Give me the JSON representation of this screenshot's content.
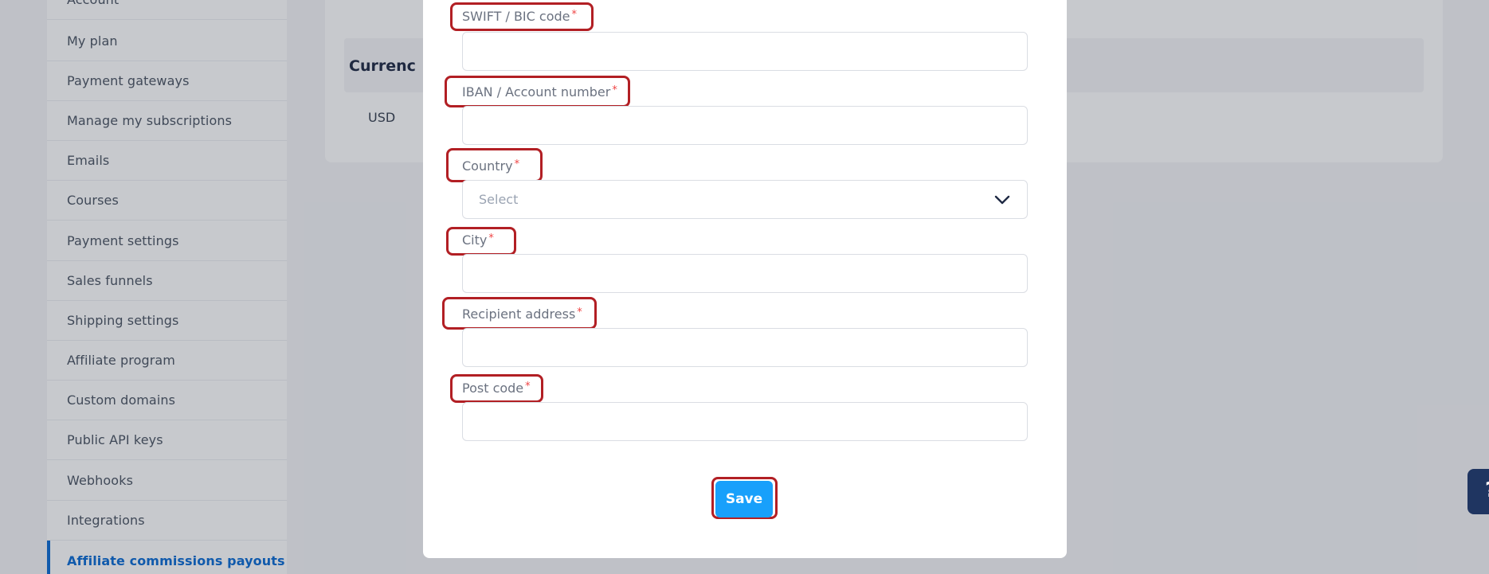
{
  "sidebar": {
    "items": [
      {
        "label": "Account"
      },
      {
        "label": "My plan"
      },
      {
        "label": "Payment gateways"
      },
      {
        "label": "Manage my subscriptions"
      },
      {
        "label": "Emails"
      },
      {
        "label": "Courses"
      },
      {
        "label": "Payment settings"
      },
      {
        "label": "Sales funnels"
      },
      {
        "label": "Shipping settings"
      },
      {
        "label": "Affiliate program"
      },
      {
        "label": "Custom domains"
      },
      {
        "label": "Public API keys"
      },
      {
        "label": "Webhooks"
      },
      {
        "label": "Integrations"
      },
      {
        "label": "Affiliate commissions payouts"
      }
    ],
    "active_item": "Affiliate commissions payouts"
  },
  "card": {
    "title": "Currenc",
    "value": "USD"
  },
  "modal": {
    "fields": {
      "swift": {
        "label": "SWIFT / BIC code",
        "required_mark": "*",
        "value": ""
      },
      "iban": {
        "label": "IBAN / Account number",
        "required_mark": "*",
        "value": ""
      },
      "country": {
        "label": "Country",
        "required_mark": "*",
        "placeholder": "Select"
      },
      "city": {
        "label": "City",
        "required_mark": "*",
        "value": ""
      },
      "address": {
        "label": "Recipient address",
        "required_mark": "*",
        "value": ""
      },
      "postcode": {
        "label": "Post code",
        "required_mark": "*",
        "value": ""
      }
    },
    "save_label": "Save"
  },
  "help_tab": {
    "label": "?"
  },
  "colors": {
    "primary_button": "#18a0fb",
    "highlight": "#b21f24",
    "active_nav": "#0b6bd3",
    "required": "#ef4444"
  }
}
